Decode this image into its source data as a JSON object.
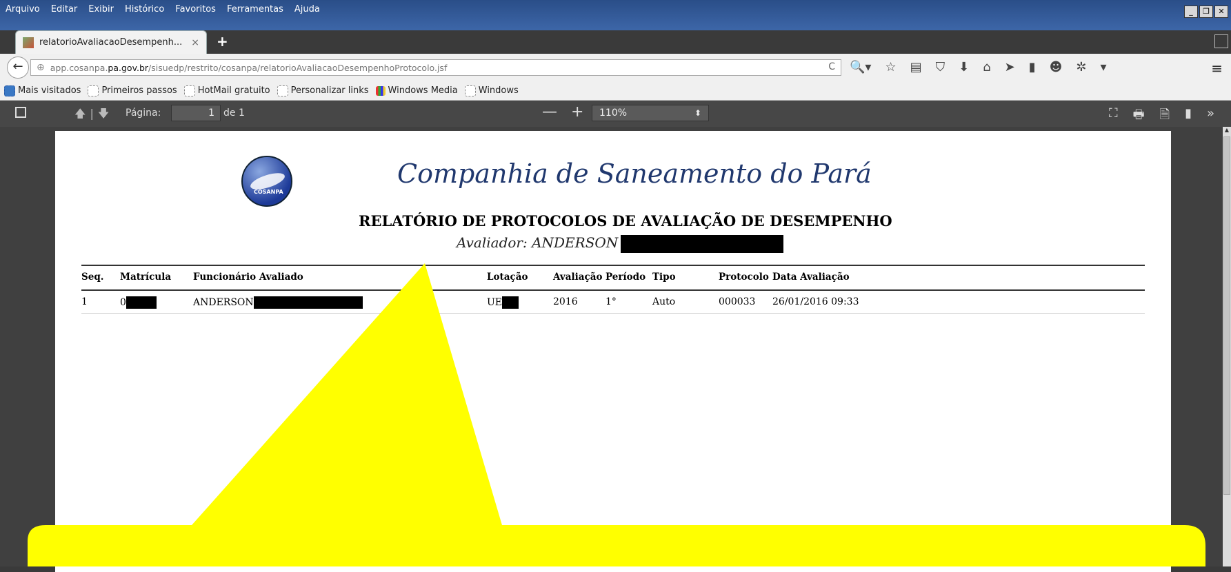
{
  "menu": [
    "Arquivo",
    "Editar",
    "Exibir",
    "Histórico",
    "Favoritos",
    "Ferramentas",
    "Ajuda"
  ],
  "window_controls": [
    "_",
    "❐",
    "✕"
  ],
  "tab": {
    "title": "relatorioAvaliacaoDesempenh...",
    "close": "×",
    "new": "+"
  },
  "navbar": {
    "back": "←",
    "url_prefix": "app.cosanpa.",
    "url_domain": "pa.gov.br",
    "url_path": "/sisuedp/restrito/cosanpa/relatorioAvaliacaoDesempenhoProtocolo.jsf",
    "reload": "C",
    "icons": [
      "search-dropdown-icon",
      "star-icon",
      "reading-list-icon",
      "pocket-icon",
      "download-icon",
      "home-icon",
      "send-icon",
      "bookmark-tag-icon",
      "chat-icon",
      "extension-icon",
      "overflow-icon"
    ],
    "icon_glyphs": [
      "🔍▾",
      "☆",
      "▤",
      "⛉",
      "⬇",
      "⌂",
      "➤",
      "▮",
      "☻",
      "✲",
      "▾"
    ],
    "menu": "≡"
  },
  "bookmarks": [
    {
      "label": "Mais visitados",
      "icon": "blue"
    },
    {
      "label": "Primeiros passos",
      "icon": "dash"
    },
    {
      "label": "HotMail gratuito",
      "icon": "dash"
    },
    {
      "label": "Personalizar links",
      "icon": "dash"
    },
    {
      "label": "Windows Media",
      "icon": "win"
    },
    {
      "label": "Windows",
      "icon": "dash"
    }
  ],
  "pdf_toolbar": {
    "page_label": "Página:",
    "page_value": "1",
    "page_total": "de 1",
    "zoom_out": "—",
    "zoom_in": "+",
    "zoom": "110%",
    "right_tools": [
      "⛶",
      "🖶",
      "🗎",
      "▮",
      "»"
    ]
  },
  "report": {
    "company": "Companhia de Saneamento do Pará",
    "logo_text": "COSANPA",
    "title": "RELATÓRIO DE PROTOCOLOS DE AVALIAÇÃO DE DESEMPENHO",
    "evaluator": "Avaliador: ANDERSON",
    "headers": [
      "Seq.",
      "Matrícula",
      "Funcionário Avaliado",
      "Lotação",
      "Avaliação",
      "Período",
      "Tipo",
      "Protocolo",
      "Data Avaliação"
    ],
    "row": {
      "seq": "1",
      "matricula": "0",
      "funcionario": "ANDERSON",
      "lotacao": "UE",
      "avaliacao": "2016",
      "periodo": "1°",
      "tipo": "Auto",
      "protocolo": "000033",
      "data": "26/01/2016 09:33"
    }
  },
  "colors": {
    "menubar": "#2a4e88",
    "pdf_toolbar": "#474747",
    "viewer": "#404040",
    "callout": "#ffff00",
    "company": "#20386e"
  }
}
